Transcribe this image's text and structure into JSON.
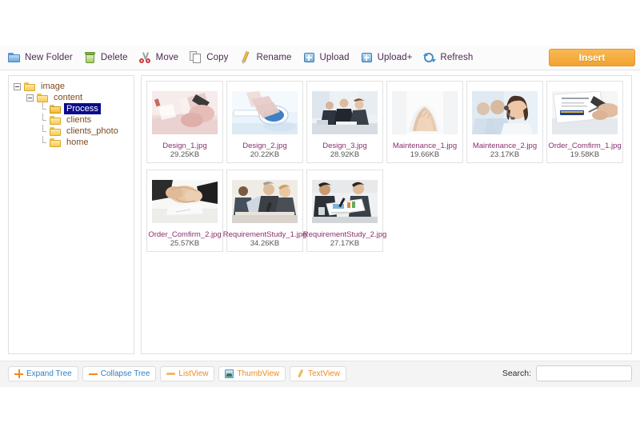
{
  "toolbar": {
    "items": [
      {
        "label": "New Folder",
        "icon": "new-folder-icon"
      },
      {
        "label": "Delete",
        "icon": "delete-icon"
      },
      {
        "label": "Move",
        "icon": "move-icon"
      },
      {
        "label": "Copy",
        "icon": "copy-icon"
      },
      {
        "label": "Rename",
        "icon": "rename-icon"
      },
      {
        "label": "Upload",
        "icon": "upload-icon"
      },
      {
        "label": "Upload+",
        "icon": "upload-plus-icon"
      },
      {
        "label": "Refresh",
        "icon": "refresh-icon"
      }
    ],
    "insert_label": "Insert",
    "insert_color": "#f1a22d"
  },
  "tree": {
    "nodes": [
      {
        "label": "image",
        "level": 0,
        "expanded": true,
        "selected": false
      },
      {
        "label": "content",
        "level": 1,
        "expanded": true,
        "selected": false
      },
      {
        "label": "Process",
        "level": 2,
        "expanded": false,
        "selected": true
      },
      {
        "label": "clients",
        "level": 2,
        "expanded": false,
        "selected": false
      },
      {
        "label": "clients_photo",
        "level": 2,
        "expanded": false,
        "selected": false
      },
      {
        "label": "home",
        "level": 2,
        "expanded": false,
        "selected": false
      }
    ],
    "selected_highlight": "#0b0b8c"
  },
  "files": [
    {
      "name": "Design_1.jpg",
      "size": "29.25KB",
      "thumb": "sketch-hand-drawing"
    },
    {
      "name": "Design_2.jpg",
      "size": "20.22KB",
      "thumb": "hand-on-mouse"
    },
    {
      "name": "Design_3.jpg",
      "size": "28.92KB",
      "thumb": "business-meeting-table"
    },
    {
      "name": "Maintenance_1.jpg",
      "size": "19.66KB",
      "thumb": "cupped-hands"
    },
    {
      "name": "Maintenance_2.jpg",
      "size": "23.17KB",
      "thumb": "call-center-headset"
    },
    {
      "name": "Order_Comfirm_1.jpg",
      "size": "19.58KB",
      "thumb": "signing-contract"
    },
    {
      "name": "Order_Comfirm_2.jpg",
      "size": "25.57KB",
      "thumb": "handshake"
    },
    {
      "name": "RequirementStudy_1.jpg",
      "size": "34.26KB",
      "thumb": "team-discussion"
    },
    {
      "name": "RequirementStudy_2.jpg",
      "size": "27.17KB",
      "thumb": "reviewing-documents"
    }
  ],
  "bottom": {
    "buttons": [
      {
        "label": "Expand Tree",
        "icon": "plus-icon",
        "color": "blue"
      },
      {
        "label": "Collapse Tree",
        "icon": "minus-icon",
        "color": "blue"
      },
      {
        "label": "ListView",
        "icon": "list-icon",
        "color": "orange"
      },
      {
        "label": "ThumbView",
        "icon": "thumbview-icon",
        "color": "orange"
      },
      {
        "label": "TextView",
        "icon": "textview-icon",
        "color": "orange"
      }
    ],
    "search_label": "Search:",
    "search_value": "",
    "search_placeholder": ""
  }
}
